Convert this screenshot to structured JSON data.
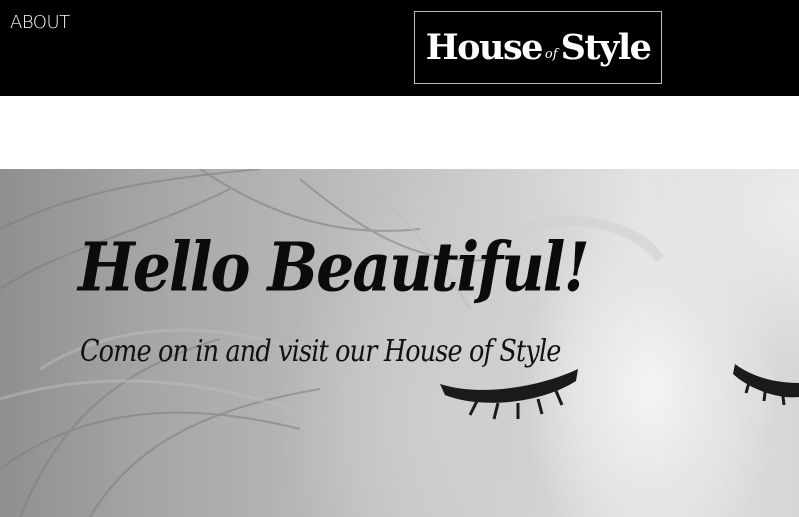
{
  "header": {
    "nav": {
      "about_label": "ABOUT"
    },
    "logo": {
      "word_1": "House",
      "word_2": "of",
      "word_3": "Style"
    }
  },
  "hero": {
    "title": "Hello Beautiful!",
    "subtitle": "Come on in and visit our House of Style"
  }
}
